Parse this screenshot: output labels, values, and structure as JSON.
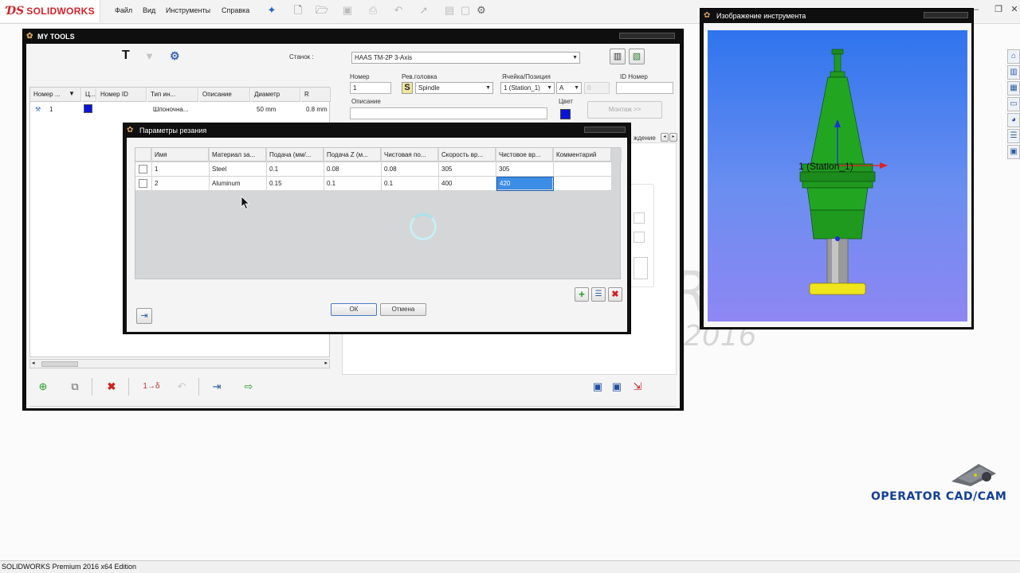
{
  "app": {
    "brand": "SOLIDWORKS",
    "menu": [
      "Файл",
      "Вид",
      "Инструменты",
      "Справка"
    ],
    "status_text": "SOLIDWORKS Premium 2016 x64 Edition",
    "watermark_year": "2016",
    "watermark_letter": "R"
  },
  "my_tools": {
    "title": "MY TOOLS",
    "machine_label": "Станок :",
    "machine_value": "HAAS TM-2P 3-Axis",
    "grid": {
      "columns": [
        "Номер ...",
        "Ц...",
        "Номер ID",
        "Тип ин...",
        "Описание",
        "Диаметр",
        "R"
      ],
      "rows": [
        {
          "num": "1",
          "color": "#0a14d8",
          "id": "",
          "type": "Шпоночна...",
          "description": "",
          "diameter": "50 mm",
          "radius": "0.8 mm"
        }
      ]
    },
    "fields": {
      "number_label": "Номер",
      "number_value": "1",
      "turret_label": "Рев.головка",
      "turret_value": "Spindle",
      "cell_label": "Ячейка/Позиция",
      "cell_value": "1 (Station_1)",
      "cell_letter": "A",
      "cell_pos": "0",
      "id_label": "ID Номер",
      "id_value": "",
      "description_label": "Описание",
      "description_value": "",
      "color_label": "Цвет",
      "color_value": "#0a14d8",
      "mount_button": "Монтаж >>",
      "tab_fragment": "ждение"
    }
  },
  "cut_params": {
    "title": "Параметры резания",
    "columns": [
      "Имя",
      "Материал за...",
      "Подача (мм/...",
      "Подача Z (м...",
      "Чистовая по...",
      "Скорость вр...",
      "Чистовое вр...",
      "Комментарий"
    ],
    "rows": [
      {
        "name": "1",
        "material": "Steel",
        "feed": "0.1",
        "feed_z": "0.08",
        "finish_feed": "0.08",
        "speed": "305",
        "finish_speed": "305",
        "comment": ""
      },
      {
        "name": "2",
        "material": "Aluminum",
        "feed": "0.15",
        "feed_z": "0.1",
        "finish_feed": "0.1",
        "speed": "400",
        "finish_speed": "420",
        "comment": ""
      }
    ],
    "ok_label": "ОК",
    "cancel_label": "Отмена"
  },
  "tool_image": {
    "title": "Изображение инструмента",
    "station_label": "1 (Station_1)"
  },
  "brand_footer": "OPERATOR CAD/CAM"
}
